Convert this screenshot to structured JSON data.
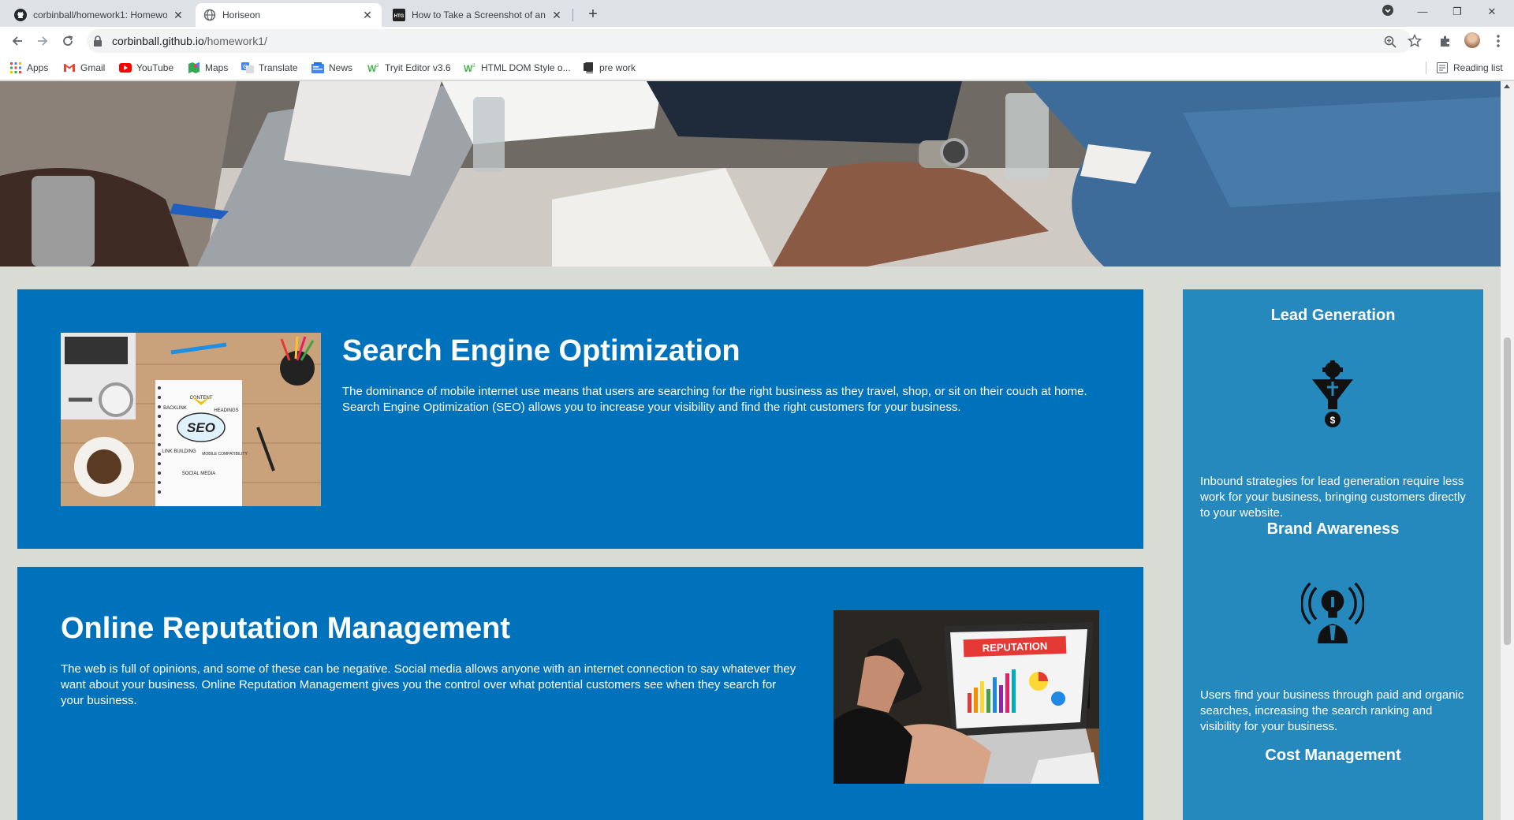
{
  "browser": {
    "tabs": [
      {
        "title": "corbinball/homework1: Homewo",
        "icon": "github-icon",
        "active": false
      },
      {
        "title": "Horiseon",
        "icon": "globe-icon",
        "active": true
      },
      {
        "title": "How to Take a Screenshot of an E",
        "icon": "htg-icon",
        "active": false
      }
    ],
    "url_host": "corbinball.github.io",
    "url_path": "/homework1/",
    "bookmarks": [
      {
        "label": "Apps",
        "icon": "apps-grid-icon"
      },
      {
        "label": "Gmail",
        "icon": "gmail-icon"
      },
      {
        "label": "YouTube",
        "icon": "youtube-icon"
      },
      {
        "label": "Maps",
        "icon": "maps-icon"
      },
      {
        "label": "Translate",
        "icon": "translate-icon"
      },
      {
        "label": "News",
        "icon": "news-icon"
      },
      {
        "label": "Tryit Editor v3.6",
        "icon": "w3schools-icon"
      },
      {
        "label": "HTML DOM Style o...",
        "icon": "w3schools-icon"
      },
      {
        "label": "pre work",
        "icon": "notebook-icon"
      }
    ],
    "reading_list": "Reading list"
  },
  "page": {
    "seo": {
      "title": "Search Engine Optimization",
      "text": "The dominance of mobile internet use means that users are searching for the right business as they travel, shop, or sit on their couch at home. Search Engine Optimization (SEO) allows you to increase your visibility and find the right customers for your business.",
      "image_labels": {
        "main": "SEO",
        "content": "CONTENT",
        "backlink": "BACKLINK",
        "headings": "HEADINGS",
        "link_building": "LINK BUILDING",
        "mobile": "MOBILE COMPATIBILITY",
        "social": "SOCIAL MEDIA"
      }
    },
    "orm": {
      "title": "Online Reputation Management",
      "text": "The web is full of opinions, and some of these can be negative. Social media allows anyone with an internet connection to say whatever they want about your business. Online Reputation Management gives you the control over what potential customers see when they search for your business.",
      "image_label": "REPUTATION"
    },
    "aside": {
      "lead": {
        "title": "Lead Generation",
        "text": "Inbound strategies for lead generation require less work for your business, bringing customers directly to your website.",
        "icon": "lead-generation-funnel-icon"
      },
      "brand": {
        "title": "Brand Awareness",
        "text": "Users find your business through paid and organic searches, increasing the search ranking and visibility for your business.",
        "icon": "brand-awareness-bulb-icon"
      },
      "cost": {
        "title": "Cost Management"
      }
    }
  },
  "colors": {
    "card_blue": "#0072bb",
    "aside_blue": "#2589bd",
    "page_bg": "#d9dbd5"
  }
}
